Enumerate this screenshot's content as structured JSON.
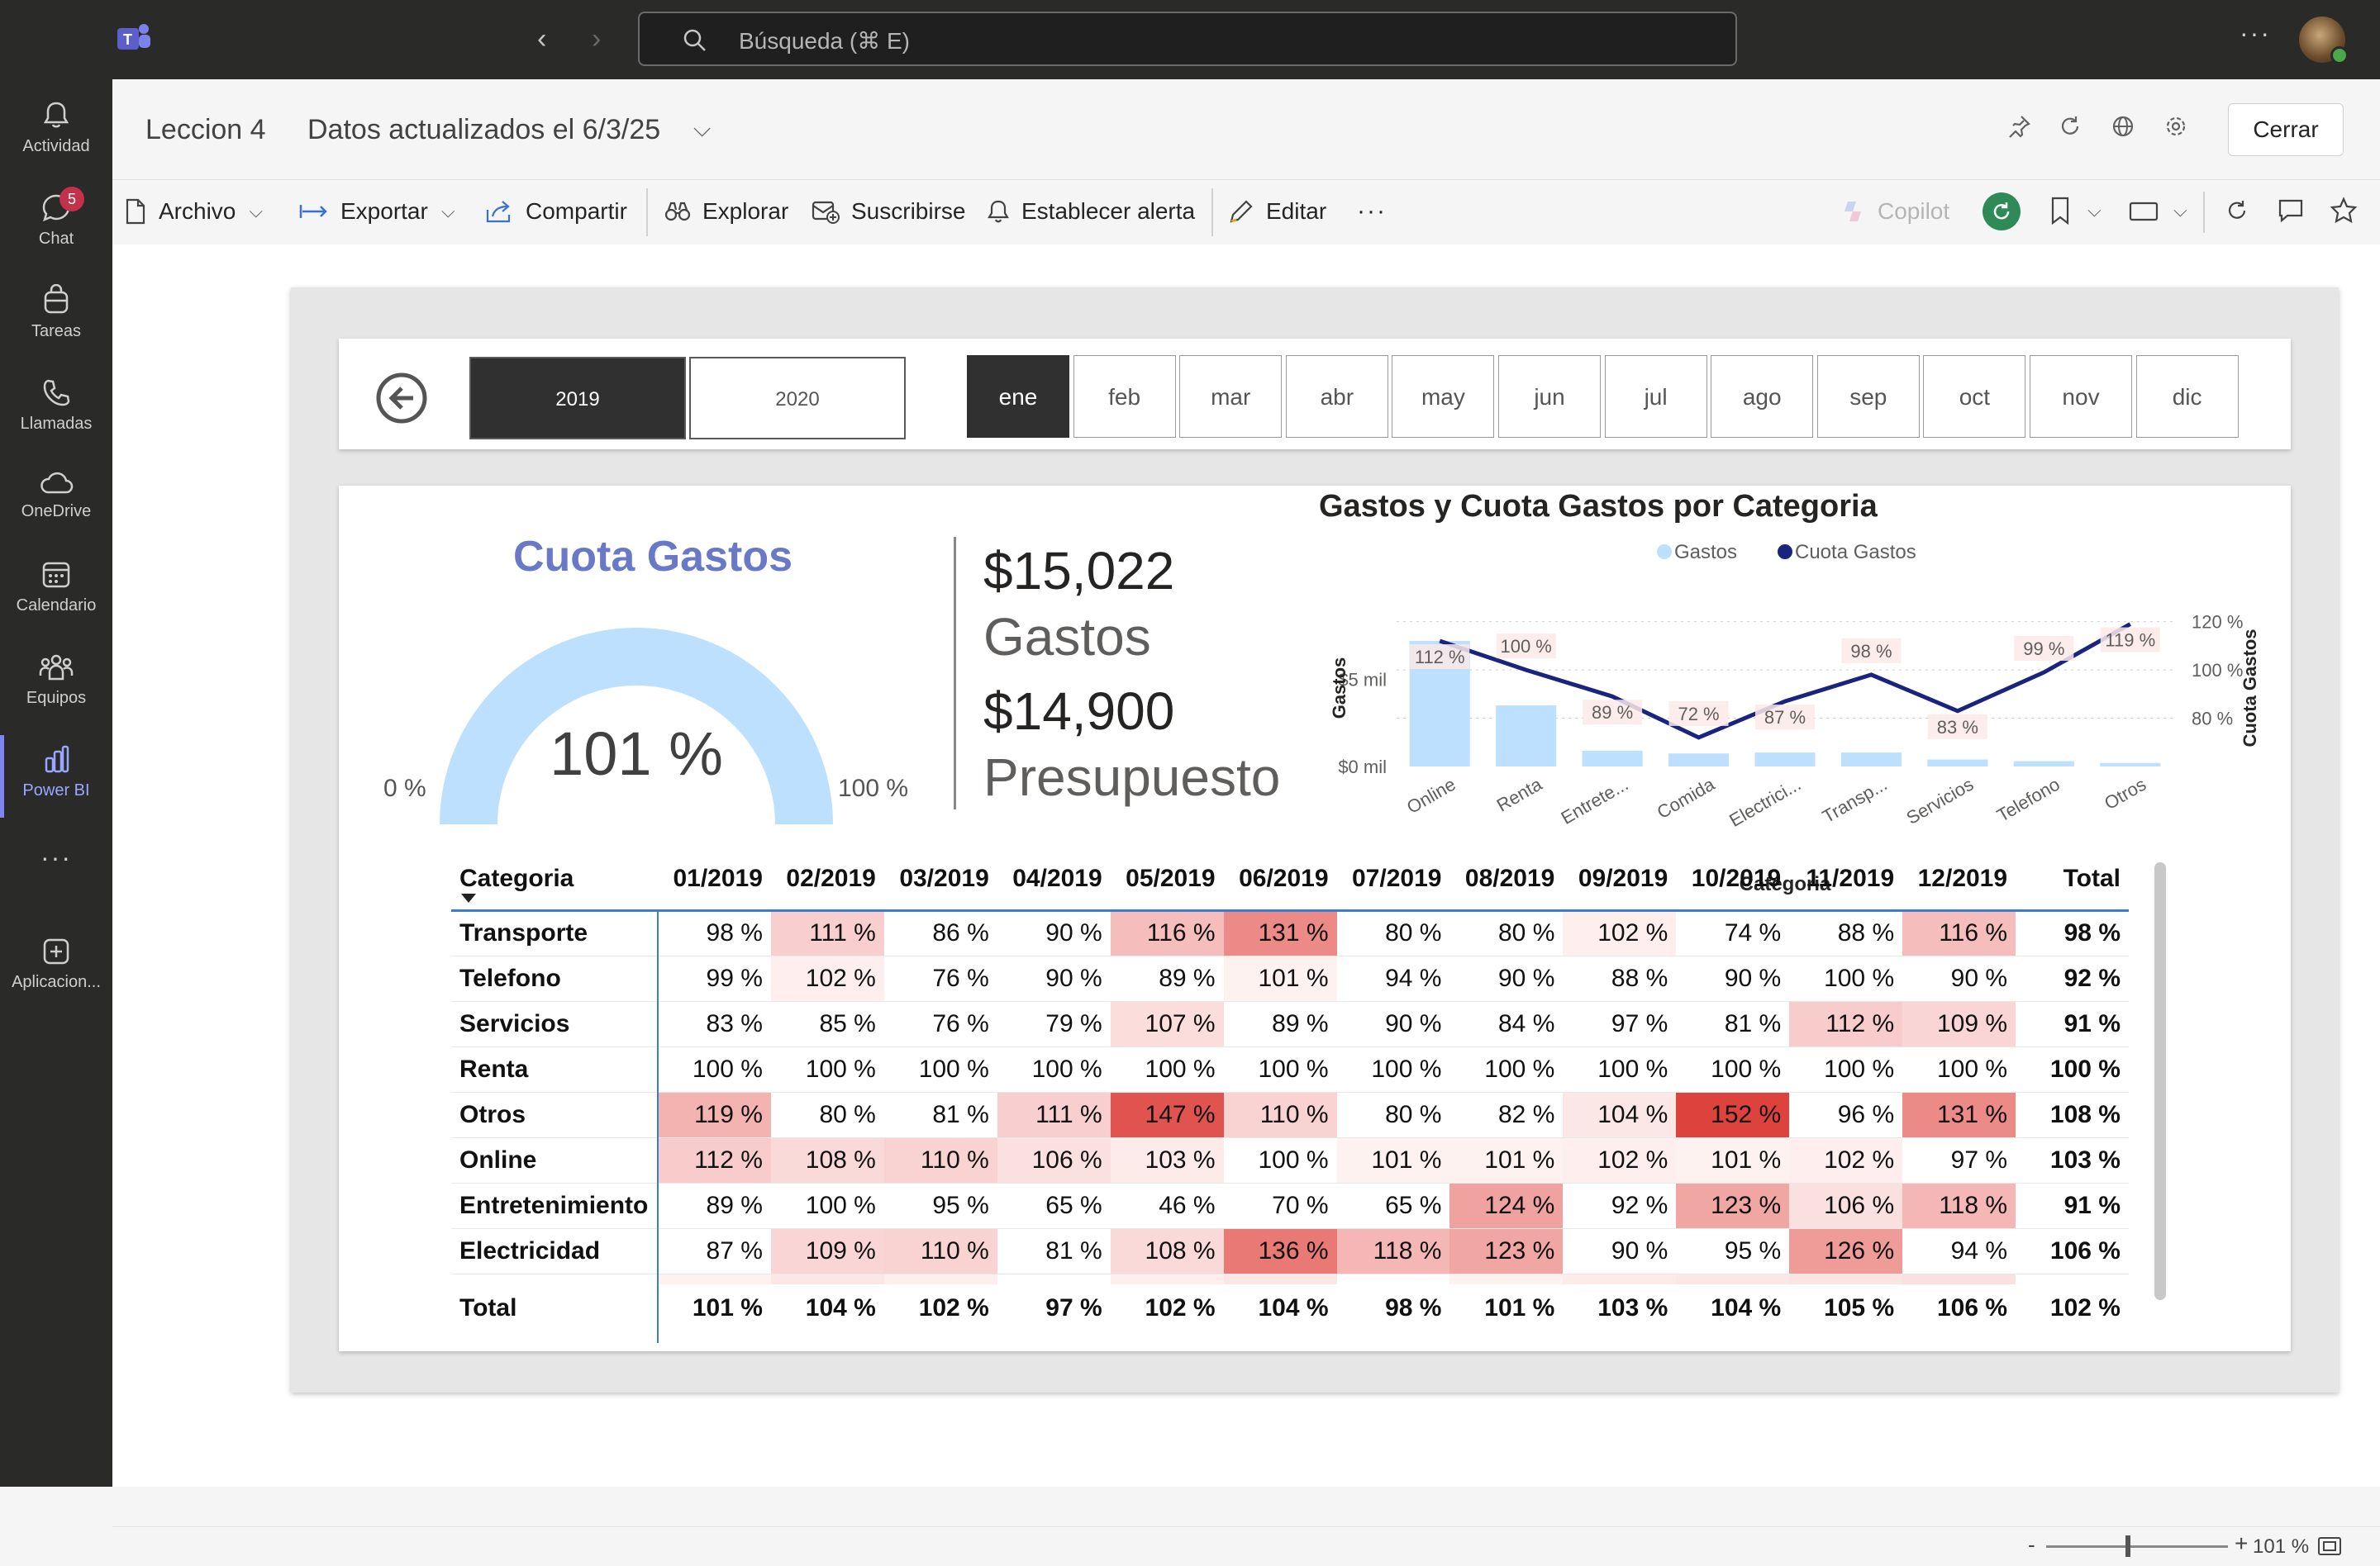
{
  "app": {
    "search_placeholder": "Búsqueda (⌘ E)",
    "accent": "#7f85f5"
  },
  "rail": [
    {
      "label": "Actividad",
      "icon": "bell-icon"
    },
    {
      "label": "Chat",
      "icon": "chat-icon",
      "badge": "5"
    },
    {
      "label": "Tareas",
      "icon": "tasks-icon"
    },
    {
      "label": "Llamadas",
      "icon": "phone-icon"
    },
    {
      "label": "OneDrive",
      "icon": "cloud-icon"
    },
    {
      "label": "Calendario",
      "icon": "calendar-icon"
    },
    {
      "label": "Equipos",
      "icon": "teams-icon"
    },
    {
      "label": "Power BI",
      "icon": "powerbi-icon",
      "active": true
    },
    {
      "label": "",
      "icon": "more-icon"
    },
    {
      "label": "Aplicacion...",
      "icon": "apps-icon"
    }
  ],
  "header": {
    "title": "Leccion 4",
    "status": "Datos actualizados el 6/3/25",
    "close_label": "Cerrar"
  },
  "toolbar": {
    "archivo": "Archivo",
    "exportar": "Exportar",
    "compartir": "Compartir",
    "explorar": "Explorar",
    "suscribirse": "Suscribirse",
    "alerta": "Establecer alerta",
    "editar": "Editar",
    "more": "···",
    "copilot": "Copilot"
  },
  "slicers": {
    "years": [
      "2019",
      "2020"
    ],
    "selected_year": "2019",
    "months": [
      "ene",
      "feb",
      "mar",
      "abr",
      "may",
      "jun",
      "jul",
      "ago",
      "sep",
      "oct",
      "nov",
      "dic"
    ],
    "selected_month": "ene"
  },
  "gauge": {
    "title": "Cuota Gastos",
    "value_label": "101 %",
    "value": 1.01,
    "min_label": "0 %",
    "max_label": "100 %",
    "color": "#bde0fe"
  },
  "kpis": {
    "gastos_value": "$15,022",
    "gastos_label": "Gastos",
    "presupuesto_value": "$14,900",
    "presupuesto_label": "Presupuesto"
  },
  "chart_data": {
    "type": "bar",
    "title": "Gastos y Cuota Gastos por Categoria",
    "xlabel": "Categoria",
    "ylabel": "Gastos",
    "y2label": "Cuota Gastos",
    "categories": [
      "Online",
      "Renta",
      "Entrete...",
      "Comida",
      "Electrici...",
      "Transp...",
      "Servicios",
      "Telefono",
      "Otros"
    ],
    "series": [
      {
        "name": "Gastos",
        "kind": "bar",
        "axis": "left",
        "color": "#bde0fe",
        "values": [
          7.2,
          3.5,
          0.9,
          0.75,
          0.8,
          0.8,
          0.4,
          0.3,
          0.2
        ]
      },
      {
        "name": "Cuota Gastos",
        "kind": "line",
        "axis": "right",
        "color": "#1a237e",
        "values": [
          112,
          100,
          89,
          72,
          87,
          98,
          83,
          99,
          119
        ],
        "labels": [
          "112 %",
          "100 %",
          "89 %",
          "72 %",
          "87 %",
          "98 %",
          "83 %",
          "99 %",
          "119 %"
        ]
      }
    ],
    "y_ticks": [
      "$0 mil",
      "$5 mil"
    ],
    "y_tick_values": [
      0,
      5
    ],
    "ylim": [
      0,
      9
    ],
    "y2_ticks": [
      "80 %",
      "100 %",
      "120 %"
    ],
    "y2_tick_values": [
      80,
      100,
      120
    ],
    "y2lim": [
      60,
      125
    ],
    "legend_position": "top-center",
    "grid": true
  },
  "matrix": {
    "header_category": "Categoria",
    "columns": [
      "01/2019",
      "02/2019",
      "03/2019",
      "04/2019",
      "05/2019",
      "06/2019",
      "07/2019",
      "08/2019",
      "09/2019",
      "10/2019",
      "11/2019",
      "12/2019",
      "Total"
    ],
    "rows": [
      {
        "name": "Transporte",
        "cells": [
          "98 %",
          "111 %",
          "86 %",
          "90 %",
          "116 %",
          "131 %",
          "80 %",
          "80 %",
          "102 %",
          "74 %",
          "88 %",
          "116 %"
        ],
        "total": "98 %"
      },
      {
        "name": "Telefono",
        "cells": [
          "99 %",
          "102 %",
          "76 %",
          "90 %",
          "89 %",
          "101 %",
          "94 %",
          "90 %",
          "88 %",
          "90 %",
          "100 %",
          "90 %"
        ],
        "total": "92 %"
      },
      {
        "name": "Servicios",
        "cells": [
          "83 %",
          "85 %",
          "76 %",
          "79 %",
          "107 %",
          "89 %",
          "90 %",
          "84 %",
          "97 %",
          "81 %",
          "112 %",
          "109 %"
        ],
        "total": "91 %"
      },
      {
        "name": "Renta",
        "cells": [
          "100 %",
          "100 %",
          "100 %",
          "100 %",
          "100 %",
          "100 %",
          "100 %",
          "100 %",
          "100 %",
          "100 %",
          "100 %",
          "100 %"
        ],
        "total": "100 %"
      },
      {
        "name": "Otros",
        "cells": [
          "119 %",
          "80 %",
          "81 %",
          "111 %",
          "147 %",
          "110 %",
          "80 %",
          "82 %",
          "104 %",
          "152 %",
          "96 %",
          "131 %"
        ],
        "total": "108 %"
      },
      {
        "name": "Online",
        "cells": [
          "112 %",
          "108 %",
          "110 %",
          "106 %",
          "103 %",
          "100 %",
          "101 %",
          "101 %",
          "102 %",
          "101 %",
          "102 %",
          "97 %"
        ],
        "total": "103 %"
      },
      {
        "name": "Entretenimiento",
        "cells": [
          "89 %",
          "100 %",
          "95 %",
          "65 %",
          "46 %",
          "70 %",
          "65 %",
          "124 %",
          "92 %",
          "123 %",
          "106 %",
          "118 %"
        ],
        "total": "91 %"
      },
      {
        "name": "Electricidad",
        "cells": [
          "87 %",
          "109 %",
          "110 %",
          "81 %",
          "108 %",
          "136 %",
          "118 %",
          "123 %",
          "90 %",
          "95 %",
          "126 %",
          "94 %"
        ],
        "total": "106 %"
      }
    ],
    "total_row": {
      "name": "Total",
      "cells": [
        "101 %",
        "104 %",
        "102 %",
        "97 %",
        "102 %",
        "104 %",
        "98 %",
        "101 %",
        "103 %",
        "104 %",
        "105 %",
        "106 %"
      ],
      "total": "102 %"
    }
  },
  "statusbar": {
    "zoom_minus": "-",
    "zoom_plus": "+",
    "zoom_level": "101 %"
  }
}
